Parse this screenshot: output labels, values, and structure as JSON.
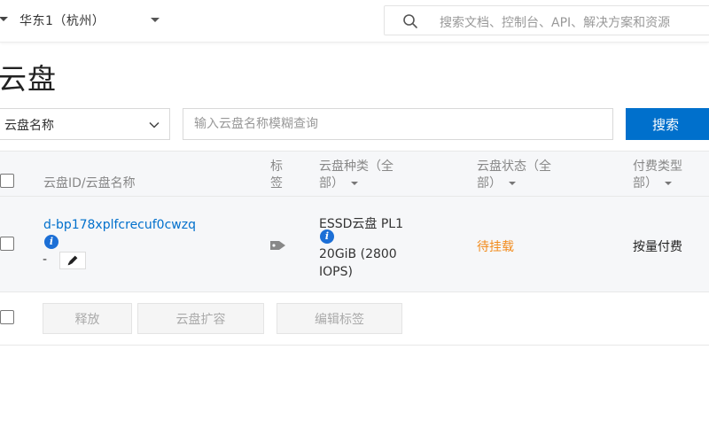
{
  "topbar": {
    "region": "华东1（杭州）",
    "search_placeholder": "搜索文档、控制台、API、解决方案和资源"
  },
  "page": {
    "title": "云盘"
  },
  "filter": {
    "select_value": "云盘名称",
    "input_placeholder": "输入云盘名称模糊查询",
    "search_label": "搜索"
  },
  "table": {
    "headers": {
      "id_name": "云盘ID/云盘名称",
      "tag_line1": "标",
      "tag_line2": "签",
      "type_line1": "云盘种类（全",
      "type_line2": "部）",
      "status_line1": "云盘状态（全",
      "status_line2": "部）",
      "billing_line1": "付费类型",
      "billing_line2": "部）"
    },
    "rows": [
      {
        "id": "d-bp178xplfcrecuf0cwzq",
        "name": "-",
        "type": "ESSD云盘  PL1",
        "size": "20GiB (2800 IOPS)",
        "status": "待挂载",
        "billing": "按量付费"
      }
    ],
    "actions": {
      "release": "释放",
      "resize": "云盘扩容",
      "edit_tags": "编辑标签"
    }
  },
  "colors": {
    "primary": "#0070cc",
    "status_pending": "#f28c1e",
    "info_icon": "#1c6fd6"
  }
}
